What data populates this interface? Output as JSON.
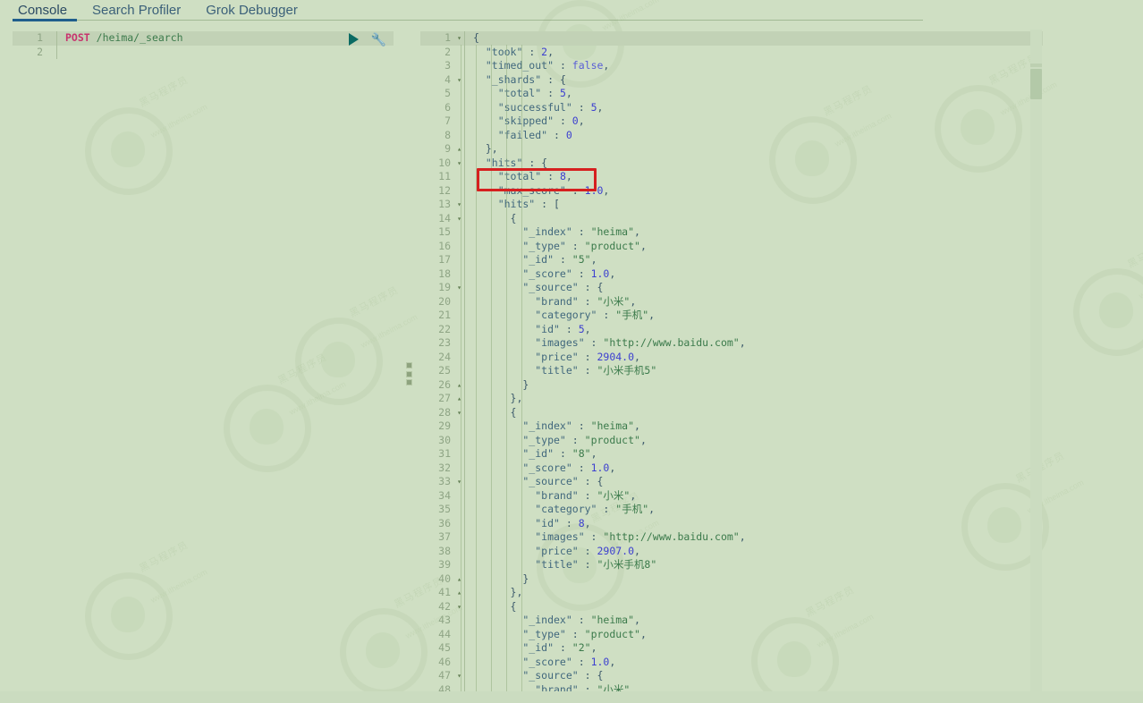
{
  "tabs": [
    {
      "label": "Console",
      "active": true
    },
    {
      "label": "Search Profiler",
      "active": false
    },
    {
      "label": "Grok Debugger",
      "active": false
    }
  ],
  "controls": {
    "play_label": "▶",
    "wrench_label": "🔧",
    "play_icon": "play-icon",
    "wrench_icon": "wrench-icon"
  },
  "request_editor": {
    "lines": [
      {
        "num": "1",
        "fold": "",
        "highlight": true,
        "tokens": [
          {
            "t": "POST",
            "c": "m"
          },
          {
            "t": " ",
            "c": "p"
          },
          {
            "t": "/heima/_search",
            "c": "u"
          }
        ]
      },
      {
        "num": "2",
        "fold": "",
        "highlight": false,
        "tokens": []
      }
    ]
  },
  "response_viewer": {
    "lines": [
      {
        "num": "1",
        "fold": "▾",
        "highlight": true,
        "tokens": [
          {
            "t": "{",
            "c": "p"
          }
        ]
      },
      {
        "num": "2",
        "fold": "",
        "highlight": false,
        "tokens": [
          {
            "t": "  \"took\"",
            "c": "k"
          },
          {
            "t": " : ",
            "c": "p"
          },
          {
            "t": "2",
            "c": "n"
          },
          {
            "t": ",",
            "c": "p"
          }
        ]
      },
      {
        "num": "3",
        "fold": "",
        "highlight": false,
        "tokens": [
          {
            "t": "  \"timed_out\"",
            "c": "k"
          },
          {
            "t": " : ",
            "c": "p"
          },
          {
            "t": "false",
            "c": "b"
          },
          {
            "t": ",",
            "c": "p"
          }
        ]
      },
      {
        "num": "4",
        "fold": "▾",
        "highlight": false,
        "tokens": [
          {
            "t": "  \"_shards\"",
            "c": "k"
          },
          {
            "t": " : {",
            "c": "p"
          }
        ]
      },
      {
        "num": "5",
        "fold": "",
        "highlight": false,
        "tokens": [
          {
            "t": "    \"total\"",
            "c": "k"
          },
          {
            "t": " : ",
            "c": "p"
          },
          {
            "t": "5",
            "c": "n"
          },
          {
            "t": ",",
            "c": "p"
          }
        ]
      },
      {
        "num": "6",
        "fold": "",
        "highlight": false,
        "tokens": [
          {
            "t": "    \"successful\"",
            "c": "k"
          },
          {
            "t": " : ",
            "c": "p"
          },
          {
            "t": "5",
            "c": "n"
          },
          {
            "t": ",",
            "c": "p"
          }
        ]
      },
      {
        "num": "7",
        "fold": "",
        "highlight": false,
        "tokens": [
          {
            "t": "    \"skipped\"",
            "c": "k"
          },
          {
            "t": " : ",
            "c": "p"
          },
          {
            "t": "0",
            "c": "n"
          },
          {
            "t": ",",
            "c": "p"
          }
        ]
      },
      {
        "num": "8",
        "fold": "",
        "highlight": false,
        "tokens": [
          {
            "t": "    \"failed\"",
            "c": "k"
          },
          {
            "t": " : ",
            "c": "p"
          },
          {
            "t": "0",
            "c": "n"
          }
        ]
      },
      {
        "num": "9",
        "fold": "▴",
        "highlight": false,
        "tokens": [
          {
            "t": "  },",
            "c": "p"
          }
        ]
      },
      {
        "num": "10",
        "fold": "▾",
        "highlight": false,
        "tokens": [
          {
            "t": "  \"hits\"",
            "c": "k"
          },
          {
            "t": " : {",
            "c": "p"
          }
        ]
      },
      {
        "num": "11",
        "fold": "",
        "highlight": false,
        "tokens": [
          {
            "t": "    \"total\"",
            "c": "k"
          },
          {
            "t": " : ",
            "c": "p"
          },
          {
            "t": "8",
            "c": "n"
          },
          {
            "t": ",",
            "c": "p"
          }
        ]
      },
      {
        "num": "12",
        "fold": "",
        "highlight": false,
        "tokens": [
          {
            "t": "    \"max_score\"",
            "c": "k"
          },
          {
            "t": " : ",
            "c": "p"
          },
          {
            "t": "1.0",
            "c": "n"
          },
          {
            "t": ",",
            "c": "p"
          }
        ]
      },
      {
        "num": "13",
        "fold": "▾",
        "highlight": false,
        "tokens": [
          {
            "t": "    \"hits\"",
            "c": "k"
          },
          {
            "t": " : [",
            "c": "p"
          }
        ]
      },
      {
        "num": "14",
        "fold": "▾",
        "highlight": false,
        "tokens": [
          {
            "t": "      {",
            "c": "p"
          }
        ]
      },
      {
        "num": "15",
        "fold": "",
        "highlight": false,
        "tokens": [
          {
            "t": "        \"_index\"",
            "c": "k"
          },
          {
            "t": " : ",
            "c": "p"
          },
          {
            "t": "\"heima\"",
            "c": "s"
          },
          {
            "t": ",",
            "c": "p"
          }
        ]
      },
      {
        "num": "16",
        "fold": "",
        "highlight": false,
        "tokens": [
          {
            "t": "        \"_type\"",
            "c": "k"
          },
          {
            "t": " : ",
            "c": "p"
          },
          {
            "t": "\"product\"",
            "c": "s"
          },
          {
            "t": ",",
            "c": "p"
          }
        ]
      },
      {
        "num": "17",
        "fold": "",
        "highlight": false,
        "tokens": [
          {
            "t": "        \"_id\"",
            "c": "k"
          },
          {
            "t": " : ",
            "c": "p"
          },
          {
            "t": "\"5\"",
            "c": "s"
          },
          {
            "t": ",",
            "c": "p"
          }
        ]
      },
      {
        "num": "18",
        "fold": "",
        "highlight": false,
        "tokens": [
          {
            "t": "        \"_score\"",
            "c": "k"
          },
          {
            "t": " : ",
            "c": "p"
          },
          {
            "t": "1.0",
            "c": "n"
          },
          {
            "t": ",",
            "c": "p"
          }
        ]
      },
      {
        "num": "19",
        "fold": "▾",
        "highlight": false,
        "tokens": [
          {
            "t": "        \"_source\"",
            "c": "k"
          },
          {
            "t": " : {",
            "c": "p"
          }
        ]
      },
      {
        "num": "20",
        "fold": "",
        "highlight": false,
        "tokens": [
          {
            "t": "          \"brand\"",
            "c": "k"
          },
          {
            "t": " : ",
            "c": "p"
          },
          {
            "t": "\"小米\"",
            "c": "s"
          },
          {
            "t": ",",
            "c": "p"
          }
        ]
      },
      {
        "num": "21",
        "fold": "",
        "highlight": false,
        "tokens": [
          {
            "t": "          \"category\"",
            "c": "k"
          },
          {
            "t": " : ",
            "c": "p"
          },
          {
            "t": "\"手机\"",
            "c": "s"
          },
          {
            "t": ",",
            "c": "p"
          }
        ]
      },
      {
        "num": "22",
        "fold": "",
        "highlight": false,
        "tokens": [
          {
            "t": "          \"id\"",
            "c": "k"
          },
          {
            "t": " : ",
            "c": "p"
          },
          {
            "t": "5",
            "c": "n"
          },
          {
            "t": ",",
            "c": "p"
          }
        ]
      },
      {
        "num": "23",
        "fold": "",
        "highlight": false,
        "tokens": [
          {
            "t": "          \"images\"",
            "c": "k"
          },
          {
            "t": " : ",
            "c": "p"
          },
          {
            "t": "\"http://www.baidu.com\"",
            "c": "s"
          },
          {
            "t": ",",
            "c": "p"
          }
        ]
      },
      {
        "num": "24",
        "fold": "",
        "highlight": false,
        "tokens": [
          {
            "t": "          \"price\"",
            "c": "k"
          },
          {
            "t": " : ",
            "c": "p"
          },
          {
            "t": "2904.0",
            "c": "n"
          },
          {
            "t": ",",
            "c": "p"
          }
        ]
      },
      {
        "num": "25",
        "fold": "",
        "highlight": false,
        "tokens": [
          {
            "t": "          \"title\"",
            "c": "k"
          },
          {
            "t": " : ",
            "c": "p"
          },
          {
            "t": "\"小米手机5\"",
            "c": "s"
          }
        ]
      },
      {
        "num": "26",
        "fold": "▴",
        "highlight": false,
        "tokens": [
          {
            "t": "        }",
            "c": "p"
          }
        ]
      },
      {
        "num": "27",
        "fold": "▴",
        "highlight": false,
        "tokens": [
          {
            "t": "      },",
            "c": "p"
          }
        ]
      },
      {
        "num": "28",
        "fold": "▾",
        "highlight": false,
        "tokens": [
          {
            "t": "      {",
            "c": "p"
          }
        ]
      },
      {
        "num": "29",
        "fold": "",
        "highlight": false,
        "tokens": [
          {
            "t": "        \"_index\"",
            "c": "k"
          },
          {
            "t": " : ",
            "c": "p"
          },
          {
            "t": "\"heima\"",
            "c": "s"
          },
          {
            "t": ",",
            "c": "p"
          }
        ]
      },
      {
        "num": "30",
        "fold": "",
        "highlight": false,
        "tokens": [
          {
            "t": "        \"_type\"",
            "c": "k"
          },
          {
            "t": " : ",
            "c": "p"
          },
          {
            "t": "\"product\"",
            "c": "s"
          },
          {
            "t": ",",
            "c": "p"
          }
        ]
      },
      {
        "num": "31",
        "fold": "",
        "highlight": false,
        "tokens": [
          {
            "t": "        \"_id\"",
            "c": "k"
          },
          {
            "t": " : ",
            "c": "p"
          },
          {
            "t": "\"8\"",
            "c": "s"
          },
          {
            "t": ",",
            "c": "p"
          }
        ]
      },
      {
        "num": "32",
        "fold": "",
        "highlight": false,
        "tokens": [
          {
            "t": "        \"_score\"",
            "c": "k"
          },
          {
            "t": " : ",
            "c": "p"
          },
          {
            "t": "1.0",
            "c": "n"
          },
          {
            "t": ",",
            "c": "p"
          }
        ]
      },
      {
        "num": "33",
        "fold": "▾",
        "highlight": false,
        "tokens": [
          {
            "t": "        \"_source\"",
            "c": "k"
          },
          {
            "t": " : {",
            "c": "p"
          }
        ]
      },
      {
        "num": "34",
        "fold": "",
        "highlight": false,
        "tokens": [
          {
            "t": "          \"brand\"",
            "c": "k"
          },
          {
            "t": " : ",
            "c": "p"
          },
          {
            "t": "\"小米\"",
            "c": "s"
          },
          {
            "t": ",",
            "c": "p"
          }
        ]
      },
      {
        "num": "35",
        "fold": "",
        "highlight": false,
        "tokens": [
          {
            "t": "          \"category\"",
            "c": "k"
          },
          {
            "t": " : ",
            "c": "p"
          },
          {
            "t": "\"手机\"",
            "c": "s"
          },
          {
            "t": ",",
            "c": "p"
          }
        ]
      },
      {
        "num": "36",
        "fold": "",
        "highlight": false,
        "tokens": [
          {
            "t": "          \"id\"",
            "c": "k"
          },
          {
            "t": " : ",
            "c": "p"
          },
          {
            "t": "8",
            "c": "n"
          },
          {
            "t": ",",
            "c": "p"
          }
        ]
      },
      {
        "num": "37",
        "fold": "",
        "highlight": false,
        "tokens": [
          {
            "t": "          \"images\"",
            "c": "k"
          },
          {
            "t": " : ",
            "c": "p"
          },
          {
            "t": "\"http://www.baidu.com\"",
            "c": "s"
          },
          {
            "t": ",",
            "c": "p"
          }
        ]
      },
      {
        "num": "38",
        "fold": "",
        "highlight": false,
        "tokens": [
          {
            "t": "          \"price\"",
            "c": "k"
          },
          {
            "t": " : ",
            "c": "p"
          },
          {
            "t": "2907.0",
            "c": "n"
          },
          {
            "t": ",",
            "c": "p"
          }
        ]
      },
      {
        "num": "39",
        "fold": "",
        "highlight": false,
        "tokens": [
          {
            "t": "          \"title\"",
            "c": "k"
          },
          {
            "t": " : ",
            "c": "p"
          },
          {
            "t": "\"小米手机8\"",
            "c": "s"
          }
        ]
      },
      {
        "num": "40",
        "fold": "▴",
        "highlight": false,
        "tokens": [
          {
            "t": "        }",
            "c": "p"
          }
        ]
      },
      {
        "num": "41",
        "fold": "▴",
        "highlight": false,
        "tokens": [
          {
            "t": "      },",
            "c": "p"
          }
        ]
      },
      {
        "num": "42",
        "fold": "▾",
        "highlight": false,
        "tokens": [
          {
            "t": "      {",
            "c": "p"
          }
        ]
      },
      {
        "num": "43",
        "fold": "",
        "highlight": false,
        "tokens": [
          {
            "t": "        \"_index\"",
            "c": "k"
          },
          {
            "t": " : ",
            "c": "p"
          },
          {
            "t": "\"heima\"",
            "c": "s"
          },
          {
            "t": ",",
            "c": "p"
          }
        ]
      },
      {
        "num": "44",
        "fold": "",
        "highlight": false,
        "tokens": [
          {
            "t": "        \"_type\"",
            "c": "k"
          },
          {
            "t": " : ",
            "c": "p"
          },
          {
            "t": "\"product\"",
            "c": "s"
          },
          {
            "t": ",",
            "c": "p"
          }
        ]
      },
      {
        "num": "45",
        "fold": "",
        "highlight": false,
        "tokens": [
          {
            "t": "        \"_id\"",
            "c": "k"
          },
          {
            "t": " : ",
            "c": "p"
          },
          {
            "t": "\"2\"",
            "c": "s"
          },
          {
            "t": ",",
            "c": "p"
          }
        ]
      },
      {
        "num": "46",
        "fold": "",
        "highlight": false,
        "tokens": [
          {
            "t": "        \"_score\"",
            "c": "k"
          },
          {
            "t": " : ",
            "c": "p"
          },
          {
            "t": "1.0",
            "c": "n"
          },
          {
            "t": ",",
            "c": "p"
          }
        ]
      },
      {
        "num": "47",
        "fold": "▾",
        "highlight": false,
        "tokens": [
          {
            "t": "        \"_source\"",
            "c": "k"
          },
          {
            "t": " : {",
            "c": "p"
          }
        ]
      },
      {
        "num": "48",
        "fold": "",
        "highlight": false,
        "tokens": [
          {
            "t": "          \"brand\"",
            "c": "k"
          },
          {
            "t": " : ",
            "c": "p"
          },
          {
            "t": "\"小米\"",
            "c": "s"
          },
          {
            "t": ",",
            "c": "p"
          }
        ]
      }
    ]
  },
  "annotation": {
    "name": "total-hits-highlight",
    "color": "#d6201f",
    "target_line": "11"
  },
  "watermark": {
    "text_cn": "黑马程序员",
    "text_url": "www.itheima.com"
  },
  "colors": {
    "background": "#cfdfc3",
    "active_tab_underline": "#1f5e8c",
    "string": "#3b7a4b",
    "number": "#3c3fd0",
    "method": "#c8336e"
  }
}
